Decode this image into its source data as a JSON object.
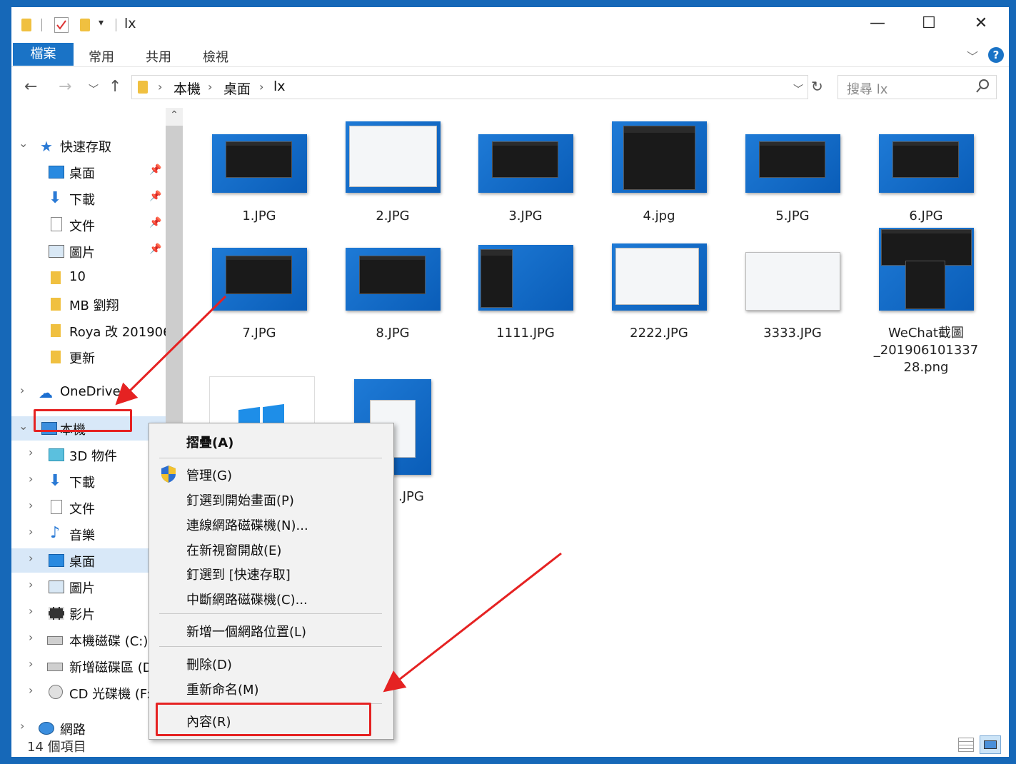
{
  "window": {
    "title": "lx",
    "controls": {
      "minimize": "—",
      "maximize": "☐",
      "close": "✕"
    }
  },
  "ribbon": {
    "file_tab": "檔案",
    "tabs": [
      "常用",
      "共用",
      "檢視"
    ],
    "help": "?"
  },
  "address": {
    "crumbs": [
      "本機",
      "桌面",
      "lx"
    ],
    "search_placeholder": "搜尋 lx"
  },
  "nav": {
    "quick_access": "快速存取",
    "quick_items": [
      "桌面",
      "下載",
      "文件",
      "圖片",
      "10",
      "MB 劉翔",
      "Roya 改 201906",
      "更新"
    ],
    "onedrive": "OneDrive",
    "this_pc": "本機",
    "pc_items": [
      "3D 物件",
      "下載",
      "文件",
      "音樂",
      "桌面",
      "圖片",
      "影片",
      "本機磁碟 (C:)",
      "新增磁碟區 (D",
      "CD 光碟機 (F:"
    ],
    "network": "網路"
  },
  "files": {
    "row1": [
      "1.JPG",
      "2.JPG",
      "3.JPG",
      "4.jpg",
      "5.JPG",
      "6.JPG"
    ],
    "row2": [
      "7.JPG",
      "8.JPG",
      "1111.JPG",
      "2222.JPG",
      "3333.JPG",
      "WeChat截圖\n_201906101337\n28.png"
    ],
    "row3_partial": ".JPG"
  },
  "status": {
    "count": "14 個項目"
  },
  "context_menu": {
    "collapse": "摺疊(A)",
    "manage": "管理(G)",
    "pin_start": "釘選到開始畫面(P)",
    "map_drive": "連線網路磁碟機(N)...",
    "open_new": "在新視窗開啟(E)",
    "pin_quick": "釘選到 [快速存取]",
    "disconnect": "中斷網路磁碟機(C)...",
    "add_location": "新增一個網路位置(L)",
    "delete": "刪除(D)",
    "rename": "重新命名(M)",
    "properties": "內容(R)"
  },
  "colors": {
    "accent": "#1a73c6",
    "annotation": "#e52222",
    "selection": "#d8e8f8"
  }
}
